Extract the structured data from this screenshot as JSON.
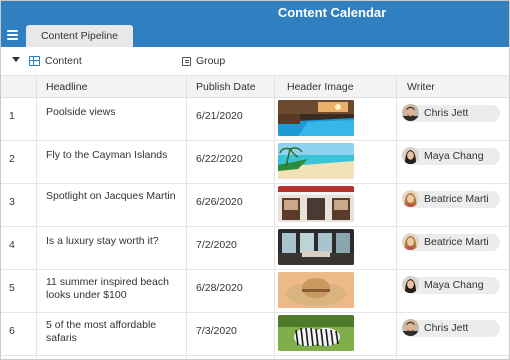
{
  "app": {
    "title": "Content Calendar",
    "tab_label": "Content Pipeline",
    "accent_color": "#2f7fc1"
  },
  "toolbar": {
    "view_label": "Content",
    "view_icon": "grid-icon",
    "group_label": "Group",
    "group_icon": "group-icon"
  },
  "table": {
    "columns": [
      "Headline",
      "Publish Date",
      "Header Image",
      "Writer"
    ],
    "rows": [
      {
        "num": "1",
        "headline": "Poolside views",
        "date": "6/21/2020",
        "image": "resort-pool-image",
        "writer": "Chris Jett"
      },
      {
        "num": "2",
        "headline": "Fly to the Cayman Islands",
        "date": "6/22/2020",
        "image": "beach-image",
        "writer": "Maya Chang"
      },
      {
        "num": "3",
        "headline": "Spotlight on Jacques Martin",
        "date": "6/26/2020",
        "image": "storefront-image",
        "writer": "Beatrice Marti"
      },
      {
        "num": "4",
        "headline": "Is a luxury stay worth it?",
        "date": "7/2/2020",
        "image": "luxury-room-image",
        "writer": "Beatrice Marti"
      },
      {
        "num": "5",
        "headline": "11 summer inspired beach looks under $100",
        "date": "6/28/2020",
        "image": "sun-hat-image",
        "writer": "Maya Chang"
      },
      {
        "num": "6",
        "headline": "5 of the most affordable safaris",
        "date": "7/3/2020",
        "image": "zebras-image",
        "writer": "Chris Jett"
      }
    ]
  }
}
